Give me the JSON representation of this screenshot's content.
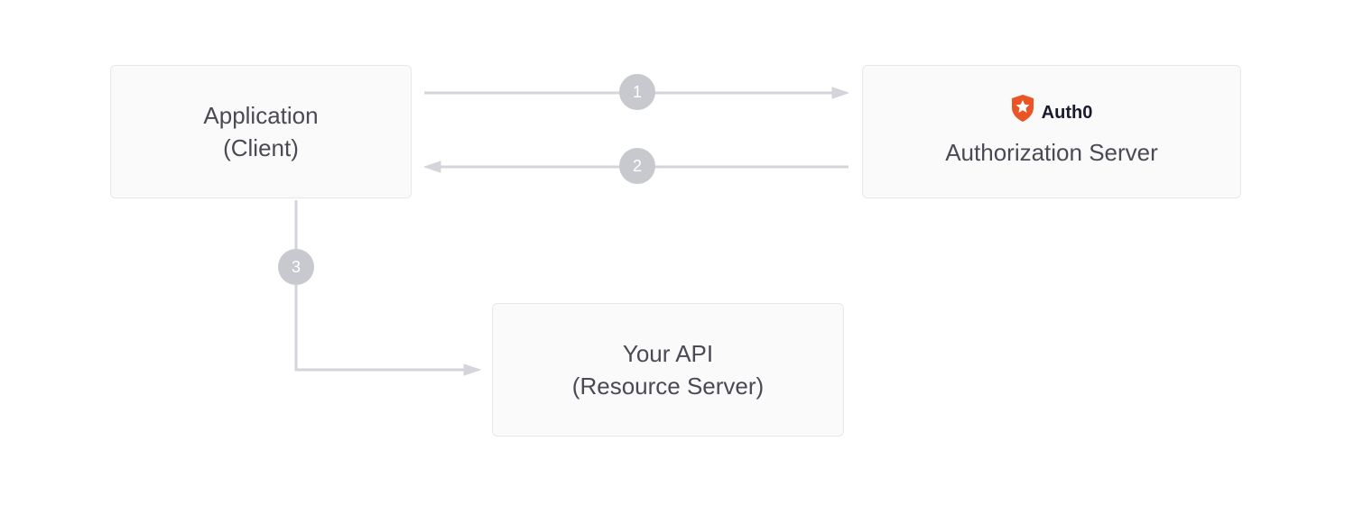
{
  "boxes": {
    "client": {
      "line1": "Application",
      "line2": "(Client)"
    },
    "auth": {
      "brand": "Auth0",
      "label": "Authorization Server"
    },
    "api": {
      "line1": "Your API",
      "line2": "(Resource Server)"
    }
  },
  "steps": {
    "one": "1",
    "two": "2",
    "three": "3"
  },
  "colors": {
    "boxBg": "#fafafb",
    "boxBorder": "#e8e8eb",
    "text": "#4a4a55",
    "arrow": "#d4d4da",
    "badgeBg": "#c8c8cf",
    "brandOrange": "#eb5424"
  }
}
